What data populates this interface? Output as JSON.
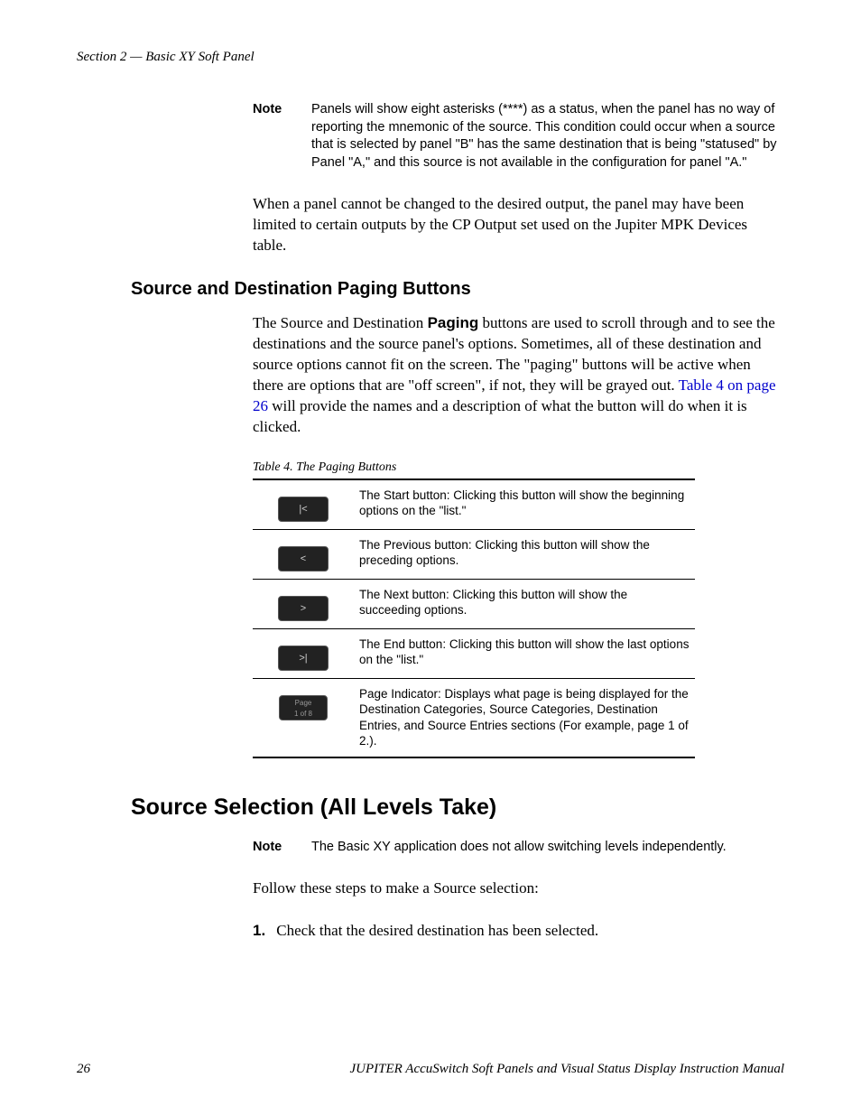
{
  "header": "Section 2 — Basic XY Soft Panel",
  "note1": {
    "label": "Note",
    "text": "Panels will show eight asterisks (****) as a status, when the panel has no way of reporting the mnemonic of the source. This condition could occur when a source that is selected by panel \"B\" has the same destination that is being \"statused\" by Panel \"A,\" and this source is not available in the configuration for panel \"A.\""
  },
  "para1": "When a panel cannot be changed to the desired output, the panel may have been limited to certain outputs by the CP Output set used on the Jupiter MPK Devices table.",
  "heading1": "Source and Destination Paging Buttons",
  "para2_a": "The Source and Destination ",
  "para2_bold": "Paging",
  "para2_b": " buttons are used to scroll through and to see the destinations and the source panel's options. Sometimes, all of these destination and source options cannot fit on the screen. The \"paging\" buttons will be active when there are options that are \"off screen\", if not, they will be grayed out. ",
  "para2_link": "Table 4 on page 26",
  "para2_c": " will provide the names and a description of what the button will do when it is clicked.",
  "table_caption": "Table 4.  The Paging Buttons",
  "table_rows": [
    {
      "btn": "|<",
      "desc": "The Start button: Clicking this button will show the beginning options on the \"list.\""
    },
    {
      "btn": "<",
      "desc": "The Previous button: Clicking this button will show the preceding options."
    },
    {
      "btn": ">",
      "desc": "The Next button: Clicking this button will show the succeeding options."
    },
    {
      "btn": ">|",
      "desc": "The End button: Clicking this button will show the last options on the \"list.\""
    },
    {
      "btn": "Page\n1 of 8",
      "desc": "Page Indicator: Displays what page is being displayed for the Destination Categories, Source Categories, Destination Entries, and Source Entries sections (For example, page 1 of 2.)."
    }
  ],
  "heading2": "Source Selection (All Levels Take)",
  "note2": {
    "label": "Note",
    "text": "The Basic XY application does not allow switching levels independently."
  },
  "para3": "Follow these steps to make a Source selection:",
  "step1_num": "1.",
  "step1_text": "Check that the desired destination has been selected.",
  "footer_page": "26",
  "footer_title": "JUPITER AccuSwitch Soft Panels and Visual Status Display Instruction Manual"
}
